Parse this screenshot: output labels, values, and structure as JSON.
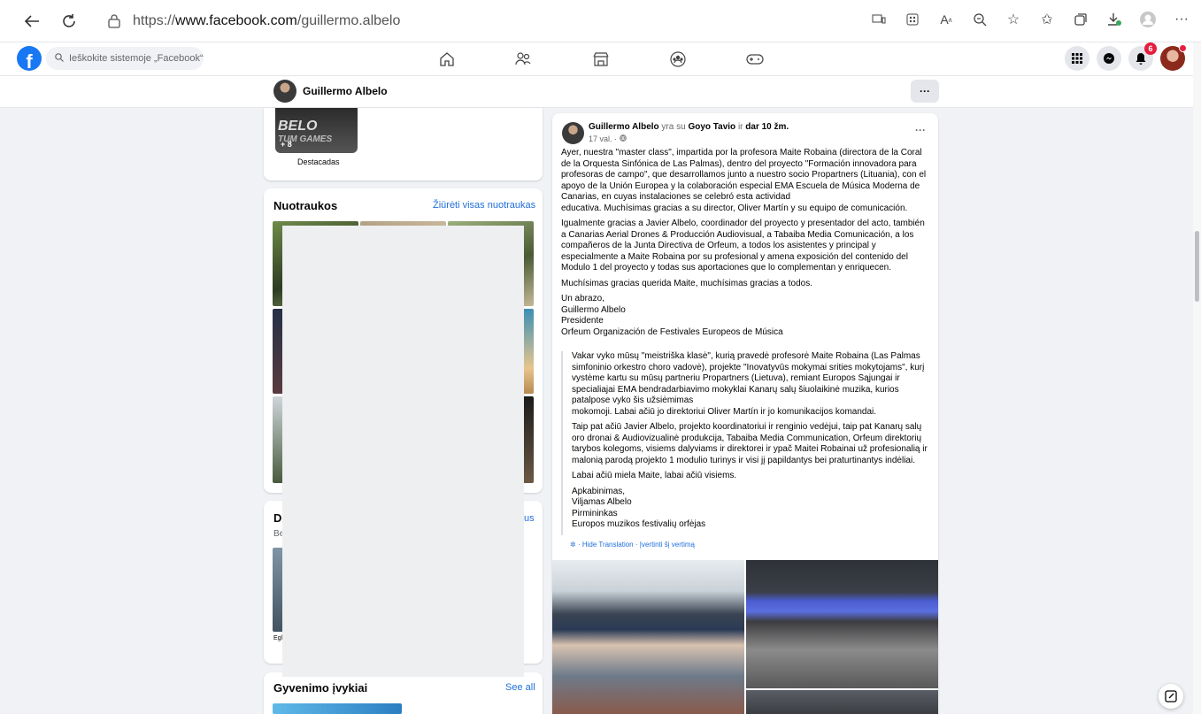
{
  "browser": {
    "url_prefix": "https://",
    "url_host": "www.facebook.com",
    "url_path": "/guillermo.albelo"
  },
  "fb": {
    "search_placeholder": "Ieškokite sistemoje „Facebook“",
    "notification_count": "6"
  },
  "profile": {
    "name": "Guillermo Albelo"
  },
  "highlights": {
    "thumb_text": "BELO",
    "thumb_sub": "TUM GAMES",
    "thumb_count": "+ 8",
    "label": "Destacadas"
  },
  "photos": {
    "title": "Nuotraukos",
    "see_all": "Žiūrėti visas nuotraukas"
  },
  "hidden_section": {
    "title_fragment": "D",
    "sub_fragment": "Be",
    "link_fragment": "us",
    "caption_fragment": "Egl"
  },
  "life_events": {
    "title": "Gyvenimo įvykiai",
    "see_all": "See all"
  },
  "post": {
    "author": "Guillermo Albelo",
    "with_text": "yra su",
    "tagged": "Goyo Tavio",
    "and_text": "ir",
    "others": "dar 10 žm.",
    "time": "17 val. ·",
    "paragraphs": [
      "Ayer, nuestra \"master class\", impartida por la profesora Maite Robaina (directora de la  Coral de la Orquesta Sinfónica de Las Palmas), dentro del proyecto \"Formación innovadora para profesoras de campo\", que desarrollamos junto a nuestro socio Propartners (Lituania), con el apoyo de la Unión Europea y la colaboración especial EMA Escuela de Música Moderna de Canarias, en cuyas instalaciones se celebró esta actividad\neducativa. Muchísimas gracias a su director, Oliver Martín y su equipo de comunicación.",
      "Igualmente gracias a Javier Albelo, coordinador del proyecto y presentador del acto, también a Canarias Aerial Drones & Producción Audiovisual, a Tabaiba Media Comunicación, a los compañeros de la Junta Directiva de Orfeum, a todos los asistentes y principal y especialmente a Maite Robaina por su profesional y amena exposición del contenido del Modulo 1 del proyecto y todas sus aportaciones que lo complementan y enriquecen.",
      "Muchísimas gracias querida Maite, muchísimas gracias a todos.",
      "Un abrazo,\nGuillermo Albelo\nPresidente\nOrfeum Organización de Festivales Europeos de Música"
    ],
    "translation": [
      "Vakar vyko mūsų \"meistriška klasė\", kurią pravedė profesorė Maite Robaina (Las Palmas simfoninio orkestro choro vadovė), projekte \"Inovatyvūs mokymai srities mokytojams\", kurį vystėme kartu su mūsų partneriu Propartners (Lietuva), remiant Europos Sąjungai ir specialiajai EMA bendradarbiavimo mokyklai Kanarų salų šiuolaikinė muzika, kurios patalpose vyko šis užsiėmimas\nmokomoji. Labai ačiū jo direktoriui Oliver Martín ir jo komunikacijos komandai.",
      "Taip pat ačiū Javier Albelo, projekto koordinatoriui ir renginio vedėjui, taip pat Kanarų salų oro dronai & Audiovizualinė produkcija, Tabaiba Media Communication, Orfeum direktorių tarybos kolegoms, visiems dalyviams ir direktorei ir ypač Maitei Robainai už profesionalią ir malonią parodą projekto 1 modulio turinys ir visi jį papildantys bei praturtinantys indėliai.",
      "Labai ačiū miela Maite, labai ačiū visiems.",
      "Apkabinimas,\nViljamas Albelo\nPirmininkas\nEuropos muzikos festivalių orfėjas"
    ],
    "hide_translation": "· Hide Translation · Įvertinti šį vertimą"
  }
}
